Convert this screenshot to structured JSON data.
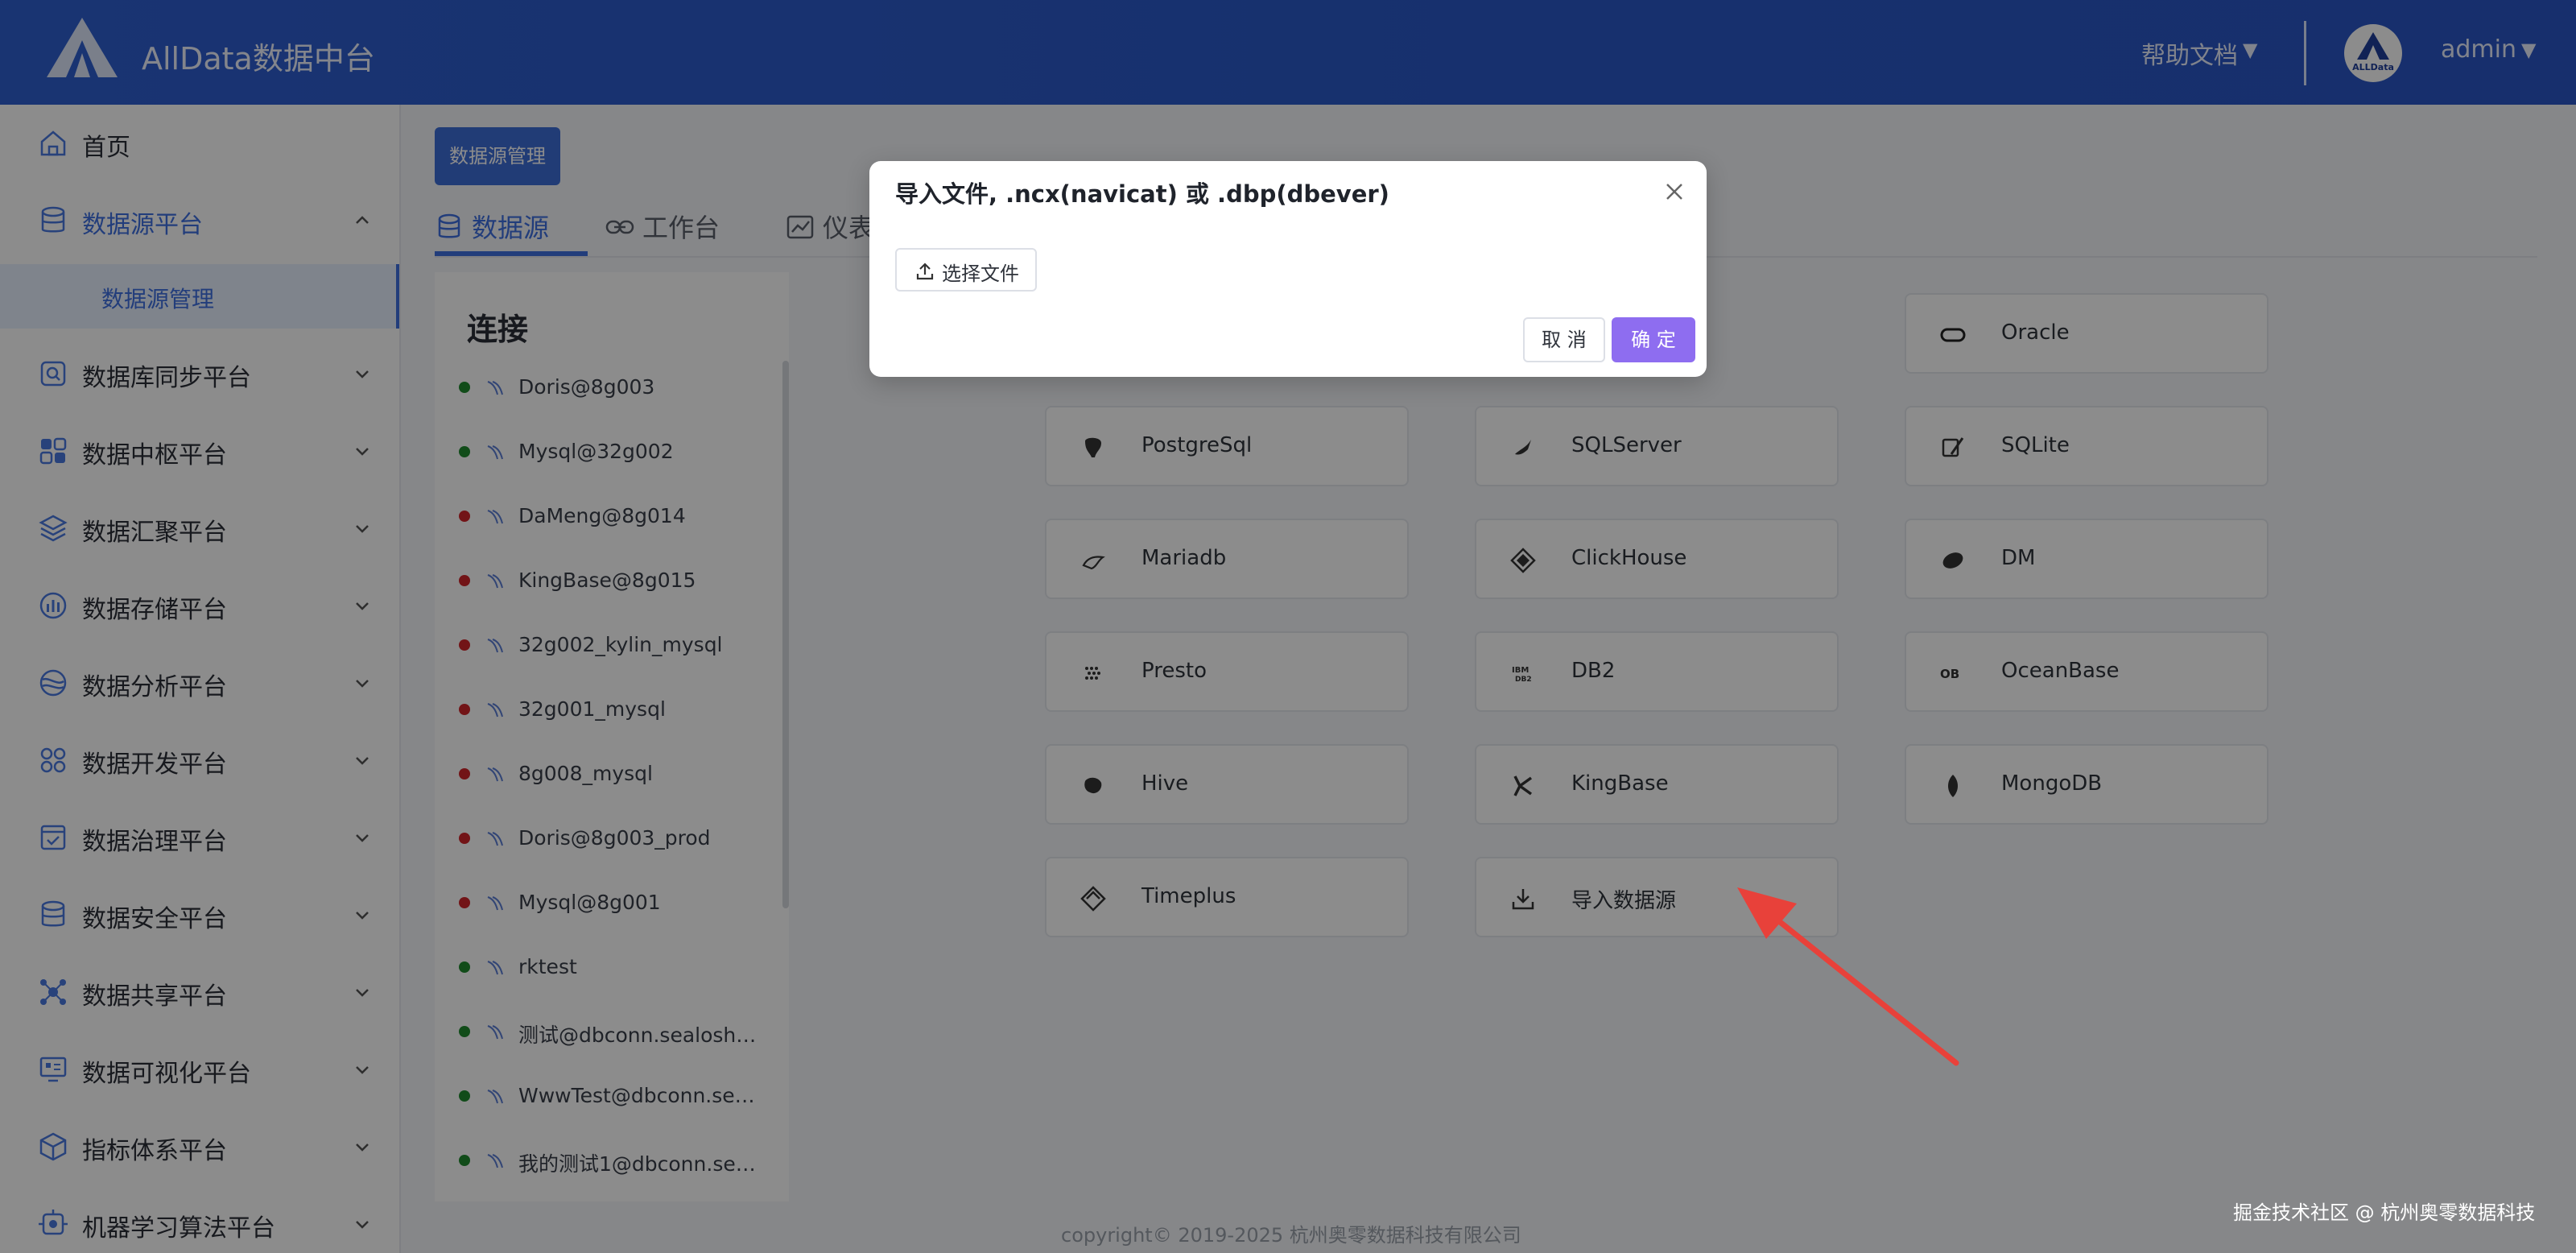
{
  "header": {
    "app_title": "AllData数据中台",
    "help_label": "帮助文档",
    "avatar_text": "ALLData",
    "user_name": "admin",
    "arrow": "▼"
  },
  "sidebar": {
    "items": [
      {
        "label": "首页",
        "icon": "home-icon"
      },
      {
        "label": "数据源平台",
        "icon": "database-icon"
      },
      {
        "label": "数据库同步平台",
        "icon": "sync-search-icon"
      },
      {
        "label": "数据中枢平台",
        "icon": "grid-icon"
      },
      {
        "label": "数据汇聚平台",
        "icon": "layers-icon"
      },
      {
        "label": "数据存储平台",
        "icon": "storage-chart-icon"
      },
      {
        "label": "数据分析平台",
        "icon": "analysis-icon"
      },
      {
        "label": "数据开发平台",
        "icon": "apps-icon"
      },
      {
        "label": "数据治理平台",
        "icon": "governance-icon"
      },
      {
        "label": "数据安全平台",
        "icon": "security-db-icon"
      },
      {
        "label": "数据共享平台",
        "icon": "share-icon"
      },
      {
        "label": "数据可视化平台",
        "icon": "monitor-icon"
      },
      {
        "label": "指标体系平台",
        "icon": "cube-icon"
      },
      {
        "label": "机器学习算法平台",
        "icon": "ml-icon"
      }
    ],
    "sub_item": "数据源管理"
  },
  "main": {
    "tag_button": "数据源管理",
    "tabs": [
      {
        "label": "数据源",
        "icon": "database-icon"
      },
      {
        "label": "工作台",
        "icon": "link-icon"
      },
      {
        "label": "仪表",
        "icon": "chart-icon"
      }
    ],
    "connections_title": "连接",
    "connections": [
      {
        "label": "Doris@8g003",
        "status": "green"
      },
      {
        "label": "Mysql@32g002",
        "status": "green"
      },
      {
        "label": "DaMeng@8g014",
        "status": "red"
      },
      {
        "label": "KingBase@8g015",
        "status": "red"
      },
      {
        "label": "32g002_kylin_mysql",
        "status": "red"
      },
      {
        "label": "32g001_mysql",
        "status": "red"
      },
      {
        "label": "8g008_mysql",
        "status": "red"
      },
      {
        "label": "Doris@8g003_prod",
        "status": "red"
      },
      {
        "label": "Mysql@8g001",
        "status": "red"
      },
      {
        "label": "rktest",
        "status": "green"
      },
      {
        "label": "测试@dbconn.sealoshzh...",
        "status": "green"
      },
      {
        "label": "WwwTest@dbconn.sealo...",
        "status": "green"
      },
      {
        "label": "我的测试1@dbconn.seal...",
        "status": "green"
      }
    ],
    "datasources": [
      {
        "label": "Oracle",
        "icon": "oracle-icon"
      },
      {
        "label": "PostgreSql",
        "icon": "postgresql-icon"
      },
      {
        "label": "SQLServer",
        "icon": "sqlserver-icon"
      },
      {
        "label": "SQLite",
        "icon": "sqlite-icon"
      },
      {
        "label": "Mariadb",
        "icon": "mariadb-icon"
      },
      {
        "label": "ClickHouse",
        "icon": "clickhouse-icon"
      },
      {
        "label": "DM",
        "icon": "dm-icon"
      },
      {
        "label": "Presto",
        "icon": "presto-icon"
      },
      {
        "label": "DB2",
        "icon": "db2-icon"
      },
      {
        "label": "OceanBase",
        "icon": "oceanbase-icon"
      },
      {
        "label": "Hive",
        "icon": "hive-icon"
      },
      {
        "label": "KingBase",
        "icon": "kingbase-icon"
      },
      {
        "label": "MongoDB",
        "icon": "mongodb-icon"
      },
      {
        "label": "Timeplus",
        "icon": "timeplus-icon"
      },
      {
        "label": "导入数据源",
        "icon": "download-icon"
      }
    ],
    "footer": "copyright© 2019-2025 杭州奥零数据科技有限公司",
    "watermark": "掘金技术社区 @ 杭州奥零数据科技"
  },
  "modal": {
    "title": "导入文件, .ncx(navicat) 或 .dbp(dbever)",
    "upload_label": "选择文件",
    "cancel_label": "取 消",
    "ok_label": "确 定"
  },
  "colors": {
    "header_blue": "#2f5fd0",
    "accent": "#3e6fe0",
    "ok_purple": "#8e6df0",
    "status_green": "#1f8a2e",
    "status_red": "#d0262b",
    "arrow_red": "#e8413a"
  }
}
